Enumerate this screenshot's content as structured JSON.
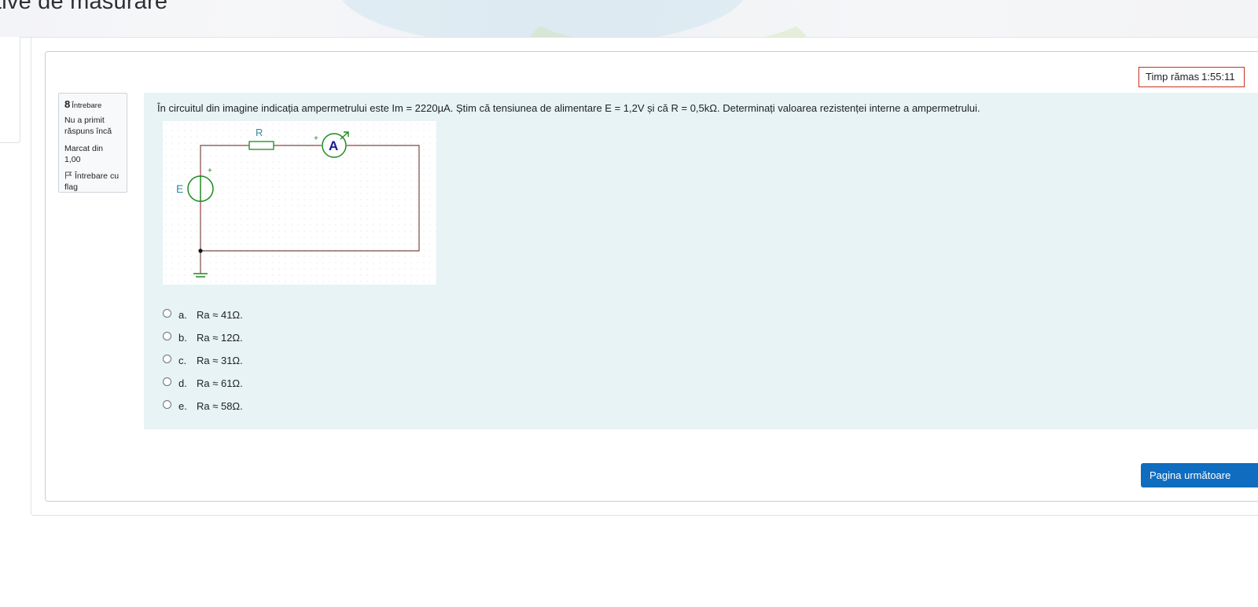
{
  "header": {
    "title": "tive de masurare"
  },
  "quiz": {
    "timer_label": "Timp rămas",
    "timer_value": "1:55:11",
    "question_info": {
      "number": "8",
      "word": "Întrebare",
      "status": "Nu a primit răspuns încă",
      "mark": "Marcat din 1,00",
      "flag_label": "Întrebare cu flag"
    },
    "question_text": "În circuitul din imagine indicația ampermetrului este Im = 2220µA. Știm că tensiunea de alimentare  E = 1,2V și că R = 0,5kΩ. Determinați valoarea rezistenței interne a ampermetrului.",
    "circuit": {
      "label_R": "R",
      "label_A": "A",
      "label_E": "E",
      "plus": "+",
      "wire_color": "#7a4a4a",
      "component_color": "#1e8a1e",
      "ammeter_text_color": "#1a1a8c",
      "label_color": "#3a8aa0"
    },
    "answers": [
      {
        "letter": "a.",
        "text": "Ra ≈ 41Ω."
      },
      {
        "letter": "b.",
        "text": "Ra ≈ 12Ω."
      },
      {
        "letter": "c.",
        "text": "Ra ≈ 31Ω."
      },
      {
        "letter": "d.",
        "text": "Ra ≈ 61Ω."
      },
      {
        "letter": "e.",
        "text": "Ra ≈ 58Ω."
      }
    ],
    "next_button": "Pagina următoare"
  },
  "colors": {
    "primary": "#0f6cbf",
    "question_bg": "#e7f3f5",
    "timer_border": "#ca3120"
  }
}
